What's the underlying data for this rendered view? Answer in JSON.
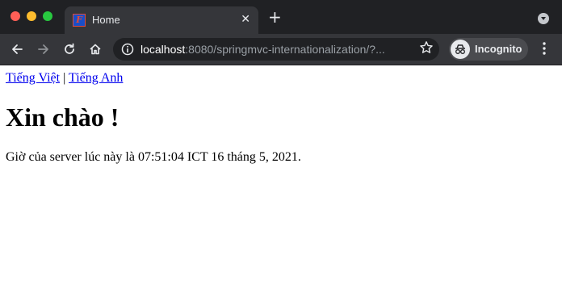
{
  "browser": {
    "tab": {
      "title": "Home",
      "close_glyph": "✕",
      "favicon": "page-favicon-icon"
    },
    "new_tab_glyph": "+",
    "address_bar": {
      "host": "localhost",
      "rest": ":8080/springmvc-internationalization/?..."
    },
    "profile_label": "Incognito",
    "colors": {
      "tab_strip": "#202124",
      "toolbar": "#35363a",
      "omnibox": "#202124",
      "close_dot": "#fe5f57",
      "minimize_dot": "#febc2e",
      "zoom_dot": "#28c840",
      "link": "#0000ee"
    }
  },
  "page": {
    "links": {
      "vietnamese": "Tiếng Việt",
      "separator": "|",
      "english": "Tiếng Anh"
    },
    "heading": "Xin chào !",
    "server_time": "Giờ của server lúc này là 07:51:04 ICT 16 tháng 5, 2021."
  }
}
